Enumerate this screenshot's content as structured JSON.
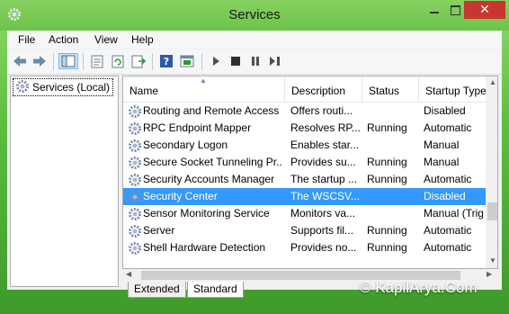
{
  "window": {
    "title": "Services",
    "close_label": "✕"
  },
  "menu": [
    "File",
    "Action",
    "View",
    "Help"
  ],
  "tree": {
    "root_label": "Services (Local)"
  },
  "columns": {
    "name": "Name",
    "description": "Description",
    "status": "Status",
    "startup": "Startup Type"
  },
  "services": [
    {
      "name": "Routing and Remote Access",
      "description": "Offers routi...",
      "status": "",
      "startup": "Disabled"
    },
    {
      "name": "RPC Endpoint Mapper",
      "description": "Resolves RP...",
      "status": "Running",
      "startup": "Automatic"
    },
    {
      "name": "Secondary Logon",
      "description": "Enables star...",
      "status": "",
      "startup": "Manual"
    },
    {
      "name": "Secure Socket Tunneling Pr...",
      "description": "Provides su...",
      "status": "Running",
      "startup": "Manual"
    },
    {
      "name": "Security Accounts Manager",
      "description": "The startup ...",
      "status": "Running",
      "startup": "Automatic"
    },
    {
      "name": "Security Center",
      "description": "The WSCSV...",
      "status": "",
      "startup": "Disabled"
    },
    {
      "name": "Sensor Monitoring Service",
      "description": "Monitors va...",
      "status": "",
      "startup": "Manual (Trig"
    },
    {
      "name": "Server",
      "description": "Supports fil...",
      "status": "Running",
      "startup": "Automatic"
    },
    {
      "name": "Shell Hardware Detection",
      "description": "Provides no...",
      "status": "Running",
      "startup": "Automatic"
    }
  ],
  "selected_service": "Security Center",
  "tabs": {
    "extended": "Extended",
    "standard": "Standard"
  },
  "watermark": "© KapilArya.Com",
  "colors": {
    "selection": "#3399ff",
    "close_button": "#c7372f",
    "background_green": "#6dc44a"
  }
}
